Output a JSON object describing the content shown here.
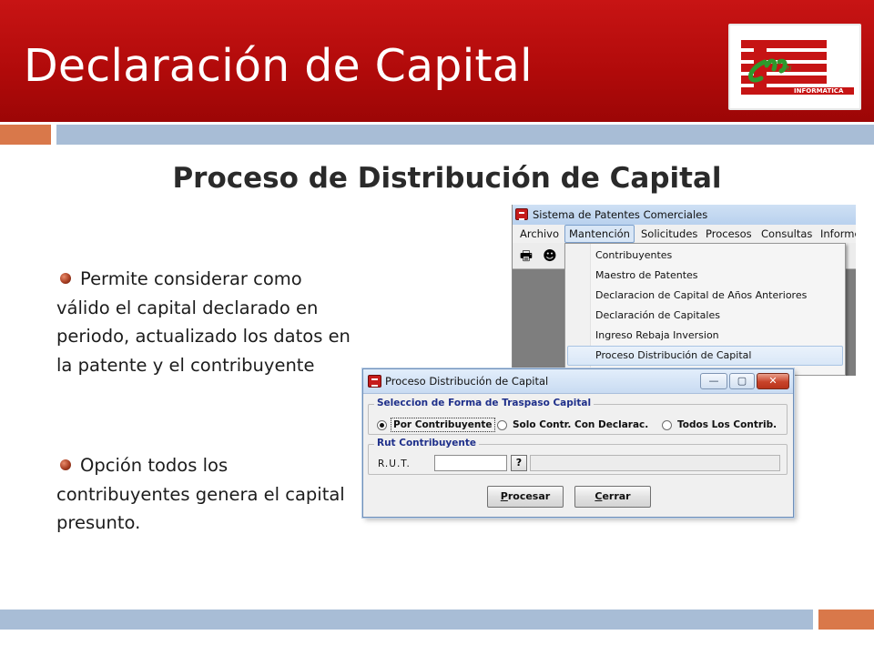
{
  "slide": {
    "title": "Declaración de Capital",
    "subtitle": "Proceso de Distribución de Capital",
    "logo_text": "INFORMATICA",
    "bullets": [
      "Permite considerar como válido el capital declarado en periodo, actualizado los datos en la patente y el contribuyente",
      "Opción todos los contribuyentes genera el capital presunto."
    ]
  },
  "colors": {
    "header_red": "#b00a0a",
    "bar_orange": "#d9784a",
    "bar_blue": "#a8bdd6",
    "legend_blue": "#1e2f8a"
  },
  "app_window": {
    "title": "Sistema de Patentes Comerciales",
    "menu": [
      "Archivo",
      "Mantención",
      "Solicitudes",
      "Procesos",
      "Consultas",
      "Informes"
    ],
    "open_menu": "Mantención",
    "toolbar_icons": [
      "printer-icon",
      "user-search-icon"
    ],
    "dropdown_items": [
      "Contribuyentes",
      "Maestro de Patentes",
      "Declaracion de Capital de Años Anteriores",
      "Declaración de Capitales",
      "Ingreso Rebaja Inversion",
      "Proceso Distribución de Capital"
    ],
    "highlighted_item": "Proceso Distribución de Capital"
  },
  "dialog": {
    "title": "Proceso Distribución de Capital",
    "window_buttons": {
      "minimize": "—",
      "maximize": "▢",
      "close": "✕"
    },
    "group_transfer": {
      "legend": "Seleccion de Forma de Traspaso Capital",
      "options": [
        "Por Contribuyente",
        "Solo Contr. Con Declarac.",
        "Todos Los Contrib."
      ],
      "selected": "Por Contribuyente"
    },
    "group_rut": {
      "legend": "Rut Contribuyente",
      "rut_label": "R.U.T.",
      "rut_value": "",
      "lookup_button": "?",
      "name_value": ""
    },
    "buttons": {
      "process_underline": "P",
      "process_rest": "rocesar",
      "close_underline": "C",
      "close_rest": "errar"
    }
  }
}
